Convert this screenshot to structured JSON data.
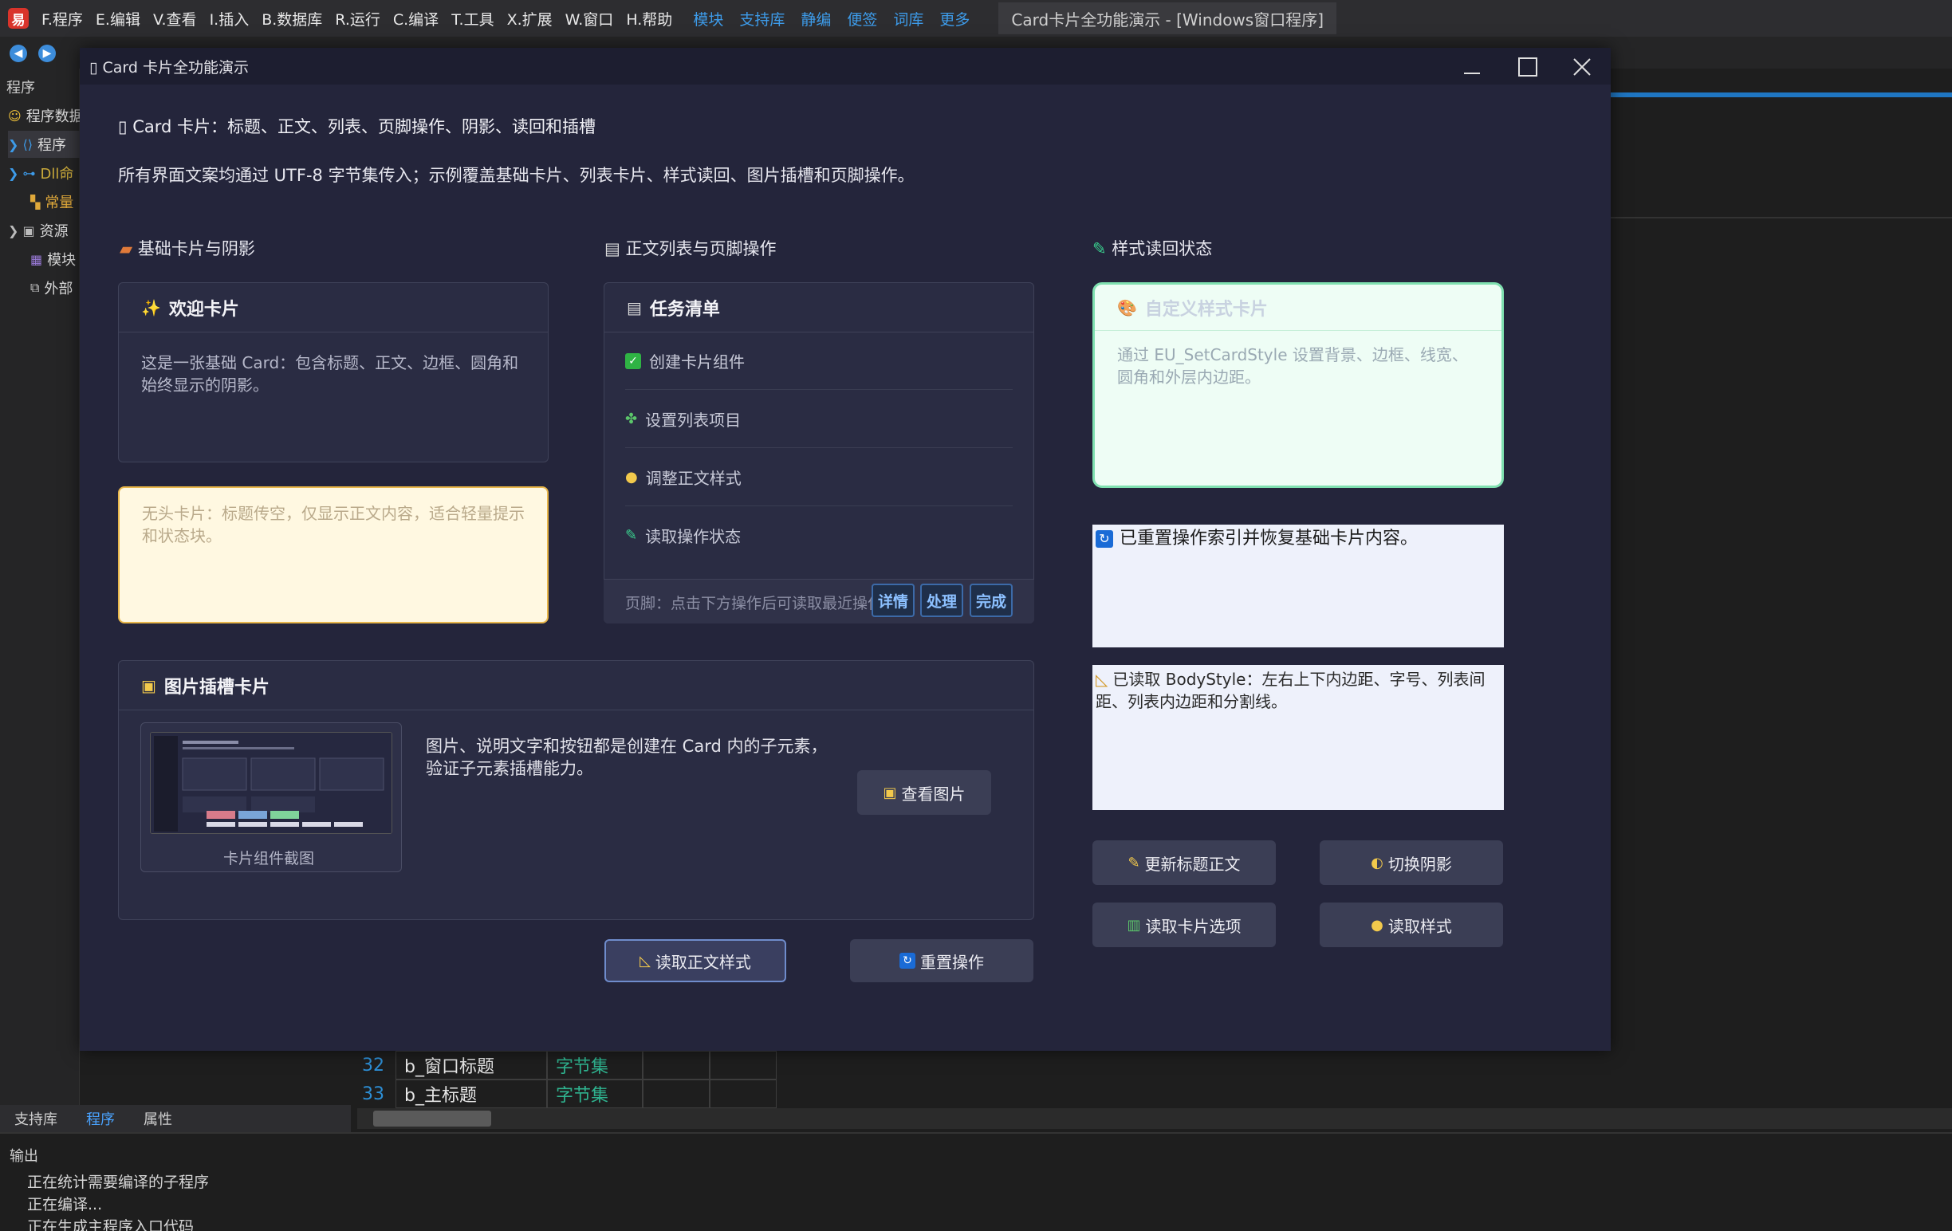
{
  "ide": {
    "menu": [
      "F.程序",
      "E.编辑",
      "V.查看",
      "I.插入",
      "B.数据库",
      "R.运行",
      "C.编译",
      "T.工具",
      "X.扩展",
      "W.窗口",
      "H.帮助"
    ],
    "links": [
      "模块",
      "支持库",
      "静编",
      "便签",
      "词库",
      "更多"
    ],
    "window_title": "Card卡片全功能演示 - [Windows窗口程序]",
    "left_header": "程序",
    "tree": [
      {
        "label": "程序数据",
        "icon": "smiley-icon",
        "color": "#d8d8d8"
      },
      {
        "label": "程序",
        "icon": "braces-icon",
        "color": "#d8d8d8"
      },
      {
        "label": "Dll命",
        "icon": "link-icon",
        "color": "#c9a93a"
      },
      {
        "label": "常量",
        "icon": "constant-icon",
        "color": "#e0a93a"
      },
      {
        "label": "资源",
        "icon": "resource-icon",
        "color": "#d8d8d8"
      },
      {
        "label": "模块",
        "icon": "module-icon",
        "color": "#d8d8d8"
      },
      {
        "label": "外部",
        "icon": "external-icon",
        "color": "#d8d8d8"
      }
    ],
    "code_rows": [
      {
        "line": "32",
        "name": "b_窗口标题",
        "type": "字节集"
      },
      {
        "line": "33",
        "name": "b_主标题",
        "type": "字节集"
      }
    ],
    "bottom_tabs": [
      "支持库",
      "程序",
      "属性"
    ],
    "output": {
      "title": "输出",
      "lines": [
        "正在统计需要编译的子程序",
        "正在编译...",
        "正在生成主程序入口代码"
      ]
    }
  },
  "dialog": {
    "title": "▯ Card 卡片全功能演示",
    "intro_title": "▯ Card 卡片：标题、正文、列表、页脚操作、阴影、读回和插槽",
    "intro_desc": "所有界面文案均通过 UTF-8 字节集传入；示例覆盖基础卡片、列表卡片、样式读回、图片插槽和页脚操作。",
    "sections": {
      "basic": "基础卡片与阴影",
      "list": "正文列表与页脚操作",
      "style": "样式读回状态"
    },
    "welcome_card": {
      "title": "欢迎卡片",
      "body": "这是一张基础 Card：包含标题、正文、边框、圆角和始终显示的阴影。"
    },
    "headless_card": {
      "body": "无头卡片：标题传空，仅显示正文内容，适合轻量提示和状态块。"
    },
    "task_card": {
      "title": "任务清单",
      "items": [
        {
          "label": "创建卡片组件",
          "icon": "check-icon"
        },
        {
          "label": "设置列表项目",
          "icon": "puzzle-icon"
        },
        {
          "label": "调整正文样式",
          "icon": "palette-icon"
        },
        {
          "label": "读取操作状态",
          "icon": "pen-icon"
        }
      ],
      "footer": "页脚：点击下方操作后可读取最近操作",
      "footer_buttons": [
        "详情",
        "处理",
        "完成"
      ]
    },
    "custom_card": {
      "title": "自定义样式卡片",
      "body": "通过 EU_SetCardStyle 设置背景、边框、线宽、圆角和外层内边距。"
    },
    "image_card": {
      "title": "图片插槽卡片",
      "caption": "卡片组件截图",
      "desc": "图片、说明文字和按钮都是创建在 Card 内的子元素，验证子元素插槽能力。",
      "button": "查看图片"
    },
    "status_box1": "已重置操作索引并恢复基础卡片内容。",
    "status_box2": "已读取 BodyStyle：左右上下内边距、字号、列表间距、列表内边距和分割线。",
    "buttons": {
      "read_body_style": "读取正文样式",
      "reset": "重置操作",
      "update_title": "更新标题正文",
      "toggle_shadow": "切换阴影",
      "read_options": "读取卡片选项",
      "read_style": "读取样式"
    },
    "colors": {
      "dialog_bg": "#24253b",
      "card_bg": "#2a2c43",
      "headless_bg": "#fff8e1",
      "headless_border": "#e8b64a",
      "custom_bg": "#eefdf5",
      "custom_border": "#7fe0b0",
      "accent_blue": "#3c6aa8"
    }
  }
}
